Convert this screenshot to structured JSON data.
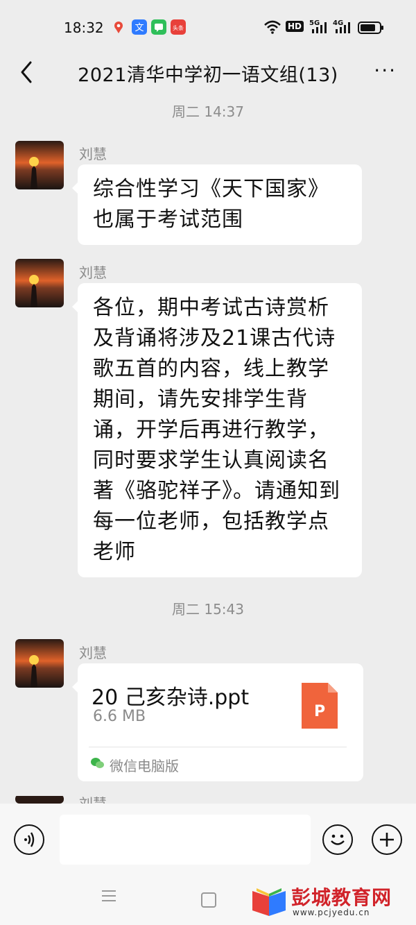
{
  "status": {
    "time": "18:32",
    "hd_label": "HD",
    "net1": "5G",
    "net2": "4G",
    "app_icon_label": "头条"
  },
  "header": {
    "title": "2021清华中学初一语文组(13)",
    "more": "···"
  },
  "messages": {
    "ts1": "周二 14:37",
    "m1_sender": "刘慧",
    "m1_text": "综合性学习《天下国家》也属于考试范围",
    "m2_sender": "刘慧",
    "m2_text": "各位，期中考试古诗赏析及背诵将涉及21课古代诗歌五首的内容，线上教学期间，请先安排学生背诵，开学后再进行教学，同时要求学生认真阅读名著《骆驼祥子》。请通知到每一位老师，包括教学点老师",
    "ts2": "周二 15:43",
    "m3_sender": "刘慧",
    "file_name": "20 己亥杂诗.ppt",
    "file_size": "6.6 MB",
    "file_icon_letter": "P",
    "file_source": "微信电脑版",
    "m4_sender": "刘慧"
  },
  "input": {
    "placeholder": ""
  },
  "watermark": {
    "title": "彭城教育网",
    "url": "www.pcjyedu.cn"
  },
  "colors": {
    "bg": "#ededed",
    "bubble": "#ffffff",
    "ppt_orange": "#f0643c",
    "watermark_red": "#d1232a"
  }
}
